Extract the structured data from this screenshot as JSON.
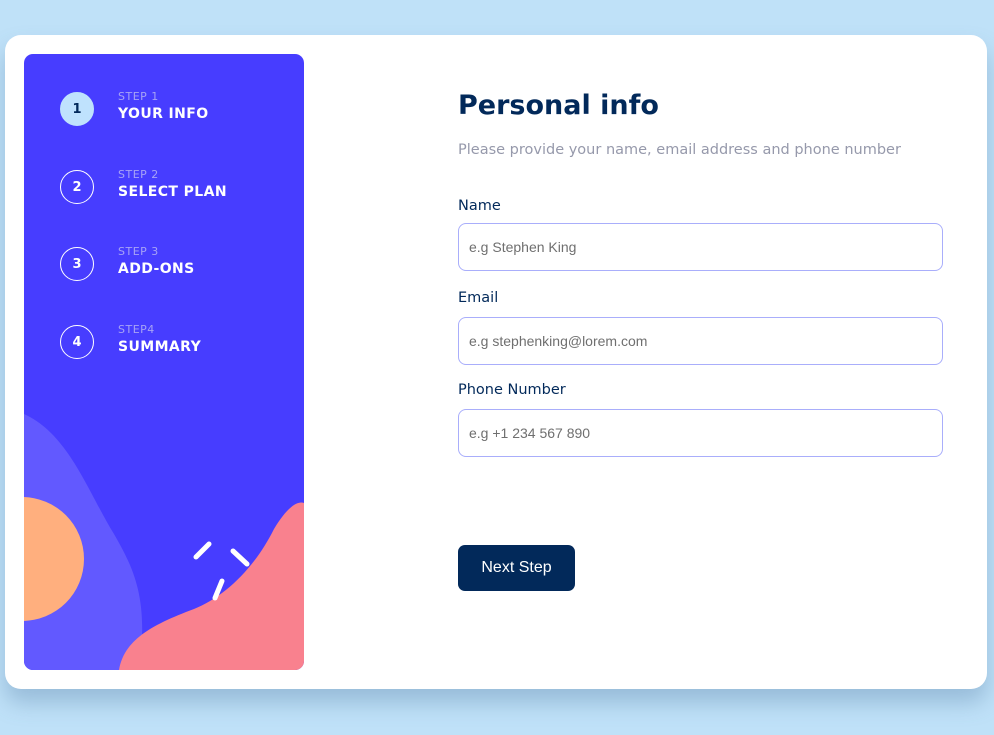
{
  "sidebar": {
    "steps": [
      {
        "number": "1",
        "label": "STEP 1",
        "title": "YOUR INFO",
        "active": true
      },
      {
        "number": "2",
        "label": "STEP 2",
        "title": "SELECT PLAN",
        "active": false
      },
      {
        "number": "3",
        "label": "STEP 3",
        "title": "ADD-ONS",
        "active": false
      },
      {
        "number": "4",
        "label": "STEP4",
        "title": "SUMMARY",
        "active": false
      }
    ],
    "colors": {
      "background": "#473dff",
      "wave": "#6259ff",
      "orange_circle": "#ffaf7e",
      "pink_blob": "#f9818e",
      "active_step": "#bfe2fd"
    }
  },
  "form": {
    "title": "Personal info",
    "subtitle": "Please provide your name, email address and phone number",
    "fields": {
      "name": {
        "label": "Name",
        "value": "",
        "placeholder": "e.g Stephen King"
      },
      "email": {
        "label": "Email",
        "value": "",
        "placeholder": "e.g stephenking@lorem.com"
      },
      "phone": {
        "label": "Phone Number",
        "value": "",
        "placeholder": "e.g +1 234 567 890"
      }
    },
    "next_button": "Next Step"
  },
  "colors": {
    "page_background": "#bfe1f8",
    "primary_text": "#02295a",
    "muted_text": "#9699ab",
    "input_border": "#a9aefb"
  }
}
